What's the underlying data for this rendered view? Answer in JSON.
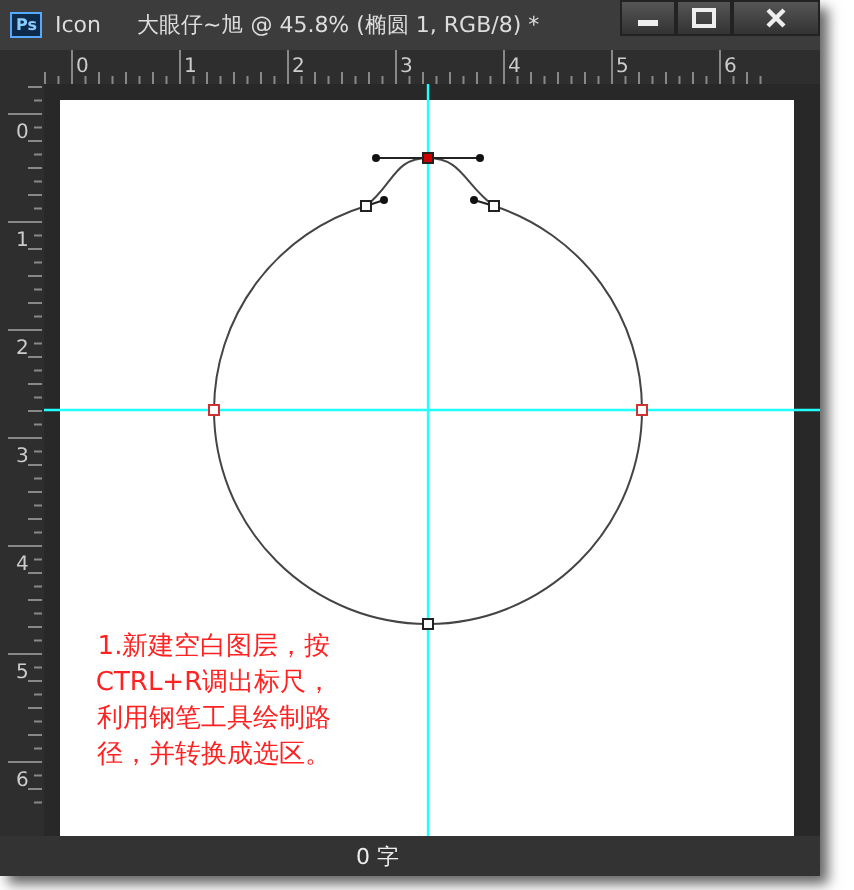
{
  "window": {
    "app_icon": "Ps",
    "app": "Icon",
    "title": "大眼仔~旭 @ 45.8% (椭圆 1, RGB/8) *"
  },
  "rulers": {
    "horizontal": [
      "0",
      "1",
      "2",
      "3",
      "4",
      "5",
      "6"
    ],
    "vertical": [
      "0",
      "1",
      "2",
      "3",
      "4",
      "5",
      "6"
    ]
  },
  "canvas": {
    "annotation": "1.新建空白图层，按CTRL+R调出标尺，利用钢笔工具绘制路径，并转换成选区。"
  },
  "status_bar": {
    "text": "0 字"
  }
}
